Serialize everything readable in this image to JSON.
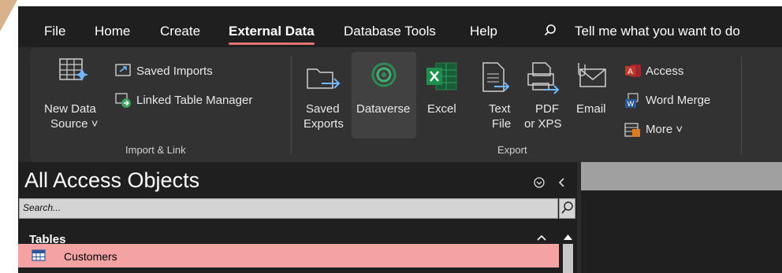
{
  "menu": {
    "tabs": [
      "File",
      "Home",
      "Create",
      "External Data",
      "Database Tools",
      "Help"
    ],
    "active_tab": "External Data",
    "tell_me": "Tell me what you want to do"
  },
  "ribbon": {
    "import_link": {
      "new_data_source": [
        "New Data",
        "Source ˅"
      ],
      "saved_imports": "Saved Imports",
      "linked_table_manager": "Linked Table Manager",
      "group_label": "Import & Link"
    },
    "export": {
      "saved_exports": [
        "Saved",
        "Exports"
      ],
      "dataverse": "Dataverse",
      "excel": "Excel",
      "text_file": [
        "Text",
        "File"
      ],
      "pdf_xps": [
        "PDF",
        "or XPS"
      ],
      "email": "Email",
      "access": "Access",
      "word_merge": "Word Merge",
      "more": "More ˅",
      "group_label": "Export"
    }
  },
  "nav": {
    "title": "All Access Objects",
    "search_placeholder": "Search...",
    "group": "Tables",
    "items": [
      "Customers"
    ]
  },
  "colors": {
    "active_tab_underline": "#e57373",
    "selected_row": "#f4a3a2",
    "excel_green": "#1d8f4e",
    "dataverse_green": "#2e8b57",
    "access_red": "#c0392b",
    "word_blue": "#2b5797"
  }
}
